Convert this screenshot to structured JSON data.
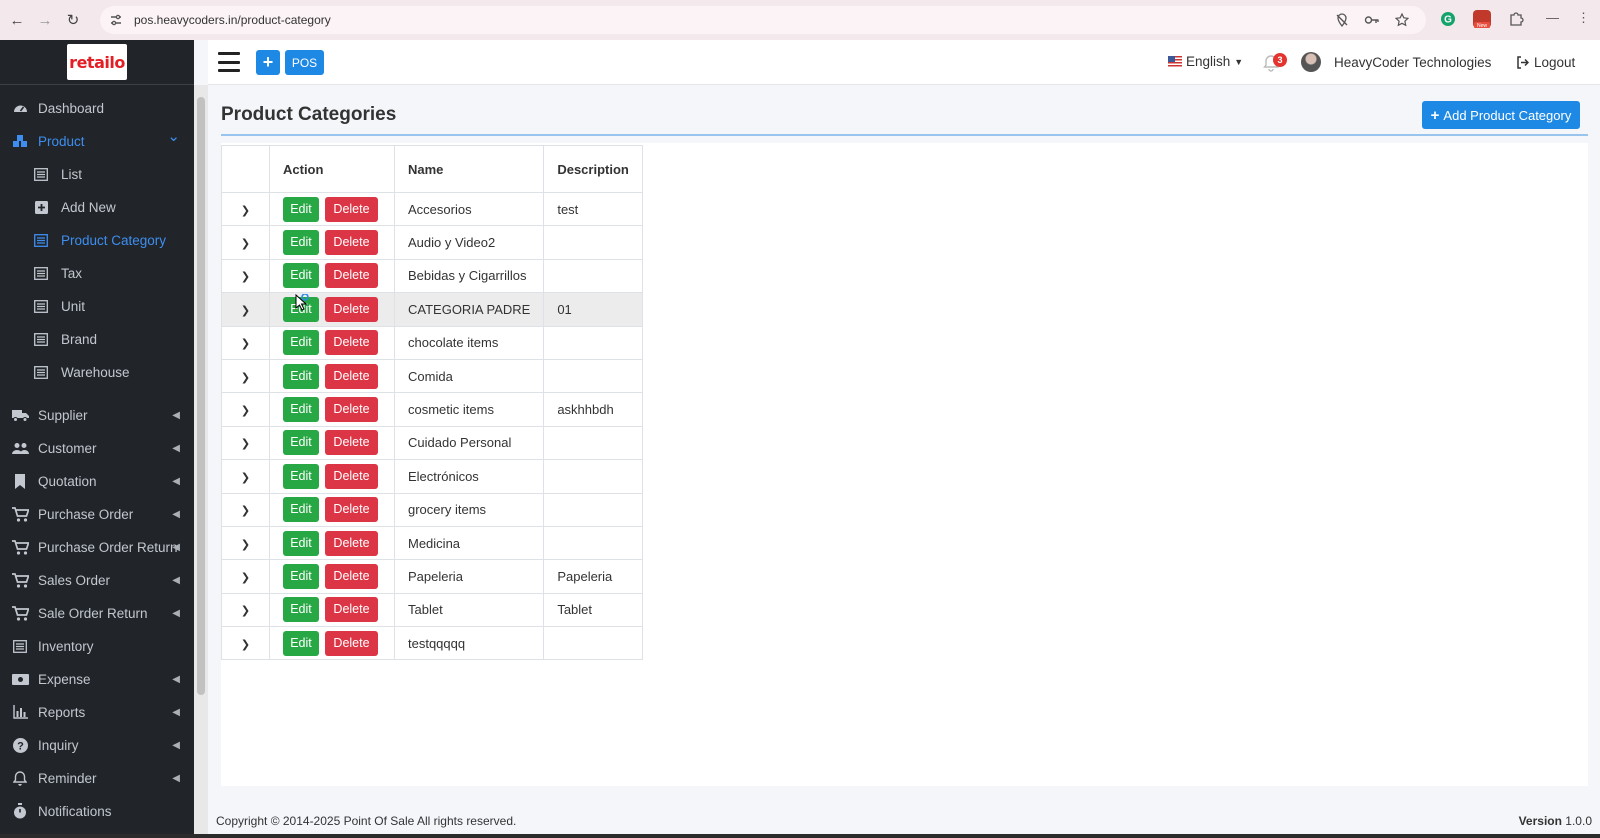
{
  "browser": {
    "url": "pos.heavycoders.in/product-category"
  },
  "sidebar": {
    "logo_text": "retailo",
    "items": [
      {
        "label": "Dashboard",
        "icon": "dashboard-icon"
      },
      {
        "label": "Product",
        "icon": "product-icon",
        "active": true,
        "expanded": true
      },
      {
        "label": "List",
        "icon": "list-icon",
        "sub": true
      },
      {
        "label": "Add New",
        "icon": "plus-square-icon",
        "sub": true
      },
      {
        "label": "Product Category",
        "icon": "list-icon",
        "sub": true,
        "active": true
      },
      {
        "label": "Tax",
        "icon": "list-icon",
        "sub": true
      },
      {
        "label": "Unit",
        "icon": "list-icon",
        "sub": true
      },
      {
        "label": "Brand",
        "icon": "list-icon",
        "sub": true
      },
      {
        "label": "Warehouse",
        "icon": "list-icon",
        "sub": true
      },
      {
        "label": "Supplier",
        "icon": "truck-icon"
      },
      {
        "label": "Customer",
        "icon": "users-icon"
      },
      {
        "label": "Quotation",
        "icon": "bookmark-icon"
      },
      {
        "label": "Purchase Order",
        "icon": "cart-icon"
      },
      {
        "label": "Purchase Order Return",
        "icon": "cart-icon"
      },
      {
        "label": "Sales Order",
        "icon": "cart-icon"
      },
      {
        "label": "Sale Order Return",
        "icon": "cart-icon"
      },
      {
        "label": "Inventory",
        "icon": "list-icon"
      },
      {
        "label": "Expense",
        "icon": "money-icon"
      },
      {
        "label": "Reports",
        "icon": "chart-icon"
      },
      {
        "label": "Inquiry",
        "icon": "question-icon"
      },
      {
        "label": "Reminder",
        "icon": "bell-icon"
      },
      {
        "label": "Notifications",
        "icon": "stopwatch-icon"
      }
    ]
  },
  "header": {
    "pos_label": "POS",
    "language": "English",
    "notification_count": "3",
    "company": "HeavyCoder Technologies",
    "logout_label": "Logout"
  },
  "page": {
    "title": "Product Categories",
    "add_button": "Add Product Category"
  },
  "table": {
    "headers": [
      "",
      "Action",
      "Name",
      "Description"
    ],
    "edit_label": "Edit",
    "delete_label": "Delete",
    "rows": [
      {
        "name": "Accesorios",
        "description": "test"
      },
      {
        "name": "Audio y Video2",
        "description": ""
      },
      {
        "name": "Bebidas y Cigarrillos",
        "description": ""
      },
      {
        "name": "CATEGORIA PADRE",
        "description": "01"
      },
      {
        "name": "chocolate items",
        "description": ""
      },
      {
        "name": "Comida",
        "description": ""
      },
      {
        "name": "cosmetic items",
        "description": "askhhbdh"
      },
      {
        "name": "Cuidado Personal",
        "description": ""
      },
      {
        "name": "Electrónicos",
        "description": ""
      },
      {
        "name": "grocery items",
        "description": ""
      },
      {
        "name": "Medicina",
        "description": ""
      },
      {
        "name": "Papeleria",
        "description": "Papeleria"
      },
      {
        "name": "Tablet",
        "description": "Tablet"
      },
      {
        "name": "testqqqqq",
        "description": ""
      }
    ]
  },
  "footer": {
    "copyright": "Copyright © 2014-2025 Point Of Sale All rights reserved.",
    "version_label": "Version",
    "version_value": "1.0.0"
  },
  "colors": {
    "sidebar_bg": "#212529",
    "primary": "#1e88e5",
    "edit": "#28a745",
    "delete": "#dc3545",
    "active_nav": "#3d8ef0"
  }
}
